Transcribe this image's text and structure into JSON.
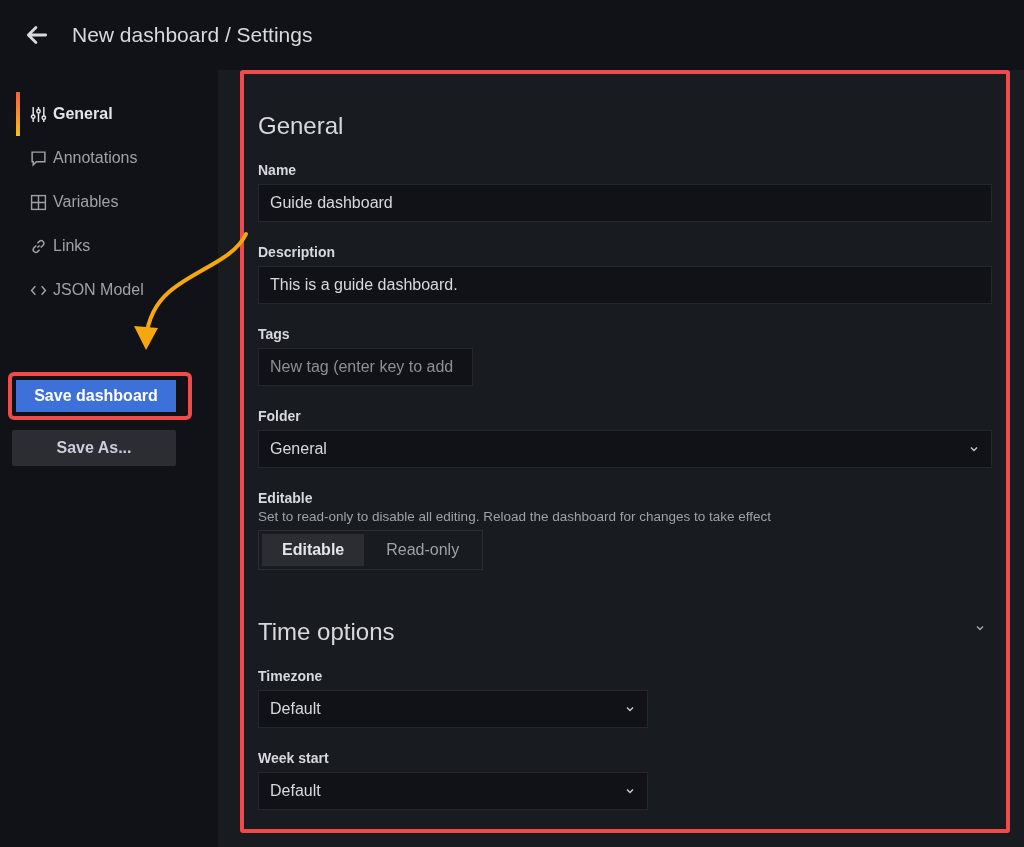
{
  "header": {
    "title": "New dashboard / Settings"
  },
  "sidebar": {
    "items": [
      {
        "label": "General",
        "selected": true
      },
      {
        "label": "Annotations",
        "selected": false
      },
      {
        "label": "Variables",
        "selected": false
      },
      {
        "label": "Links",
        "selected": false
      },
      {
        "label": "JSON Model",
        "selected": false
      }
    ],
    "buttons": [
      {
        "label": "Save dashboard",
        "kind": "primary",
        "highlighted": true
      },
      {
        "label": "Save As...",
        "kind": "secondary",
        "highlighted": false
      }
    ]
  },
  "settings": {
    "highlighted": true,
    "sections": [
      {
        "title": "General",
        "fields": [
          {
            "kind": "input",
            "label": "Name",
            "value": "Guide dashboard"
          },
          {
            "kind": "input",
            "label": "Description",
            "value": "This is a guide dashboard."
          },
          {
            "kind": "tags",
            "label": "Tags",
            "placeholder": "New tag (enter key to add"
          },
          {
            "kind": "select",
            "label": "Folder",
            "value": "General"
          },
          {
            "kind": "radio",
            "label": "Editable",
            "description": "Set to read-only to disable all editing. Reload the dashboard for changes to take effect",
            "options": [
              {
                "label": "Editable",
                "selected": true
              },
              {
                "label": "Read-only",
                "selected": false
              }
            ]
          }
        ]
      },
      {
        "title": "Time options",
        "fields": [
          {
            "kind": "select",
            "label": "Timezone",
            "value": "Default"
          },
          {
            "kind": "select",
            "label": "Week start",
            "value": "Default"
          }
        ]
      }
    ]
  }
}
